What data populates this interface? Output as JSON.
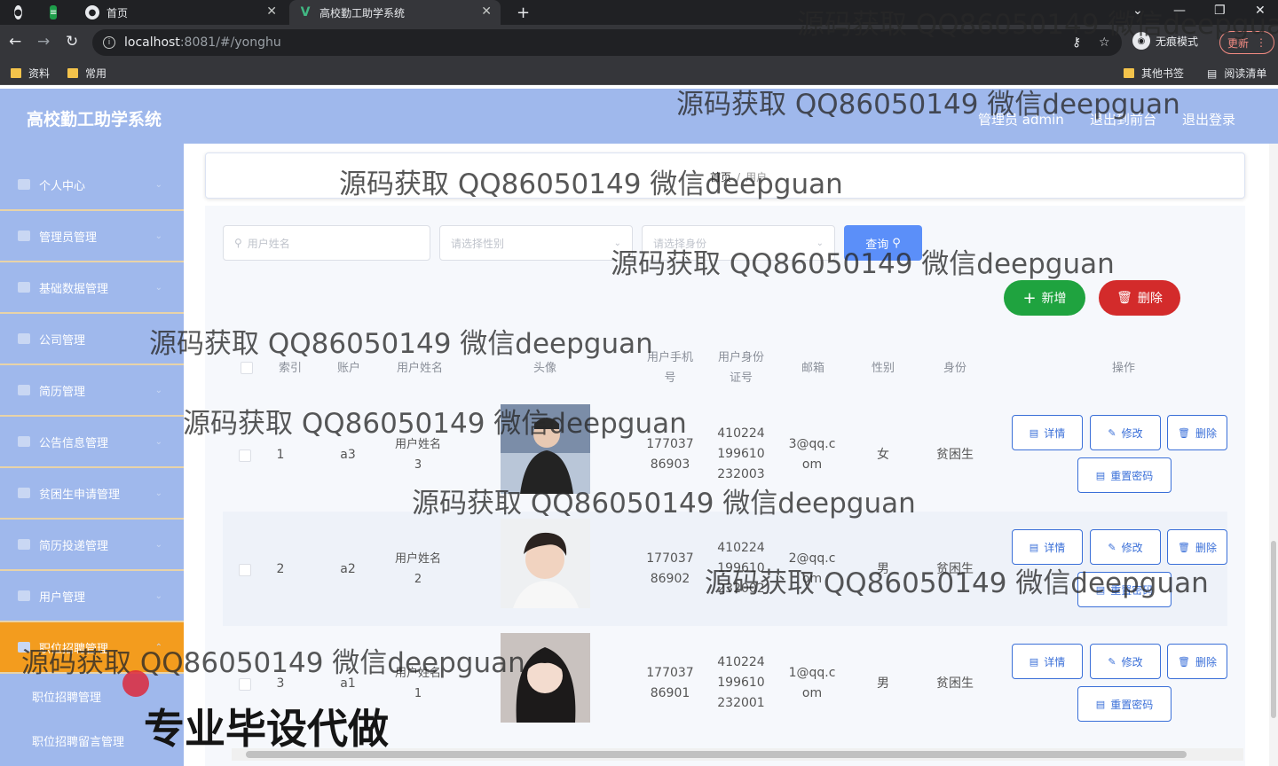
{
  "browser": {
    "tabs": [
      {
        "label": ""
      },
      {
        "label": ""
      },
      {
        "label": "首页"
      },
      {
        "label": "高校勤工助学系统"
      }
    ],
    "new_tab": "+",
    "url_host": "localhost",
    "url_path": ":8081/#/yonghu",
    "incognito_label": "无痕模式",
    "update_label": "更新",
    "bookmarks": [
      "资料",
      "常用"
    ],
    "other_bookmarks": "其他书签",
    "reading_list": "阅读清单"
  },
  "app": {
    "title": "高校勤工助学系统",
    "header_links": {
      "admin": "管理员 admin",
      "front": "退出到前台",
      "logout": "退出登录"
    },
    "menu": [
      {
        "label": "个人中心"
      },
      {
        "label": "管理员管理"
      },
      {
        "label": "基础数据管理"
      },
      {
        "label": "公司管理"
      },
      {
        "label": "简历管理"
      },
      {
        "label": "公告信息管理"
      },
      {
        "label": "贫困生申请管理"
      },
      {
        "label": "简历投递管理"
      },
      {
        "label": "用户管理"
      },
      {
        "label": "职位招聘管理"
      }
    ],
    "submenu": [
      "职位招聘管理",
      "职位招聘留言管理"
    ],
    "breadcrumb": {
      "home": "首页",
      "sep": "/",
      "current": "用户"
    },
    "search": {
      "name_placeholder": "用户姓名",
      "gender_placeholder": "请选择性别",
      "identity_placeholder": "请选择身份",
      "query": "查询"
    },
    "actions": {
      "add": "新增",
      "delete": "删除"
    },
    "table": {
      "headers": {
        "index": "索引",
        "account": "账户",
        "name": "用户姓名",
        "avatar": "头像",
        "phone": "用户手机号",
        "idcard": "用户身份证号",
        "email": "邮箱",
        "gender": "性别",
        "identity": "身份",
        "ops": "操作"
      },
      "rows": [
        {
          "index": "1",
          "account": "a3",
          "name": "用户姓名3",
          "phone": "17703786903",
          "idcard": "410224199610232003",
          "email": "3@qq.com",
          "gender": "女",
          "identity": "贫困生"
        },
        {
          "index": "2",
          "account": "a2",
          "name": "用户姓名2",
          "phone": "17703786902",
          "idcard": "410224199610232002",
          "email": "2@qq.com",
          "gender": "男",
          "identity": "贫困生"
        },
        {
          "index": "3",
          "account": "a1",
          "name": "用户姓名1",
          "phone": "17703786901",
          "idcard": "410224199610232001",
          "email": "1@qq.com",
          "gender": "男",
          "identity": "贫困生"
        }
      ],
      "row_buttons": {
        "detail": "详情",
        "edit": "修改",
        "delete": "删除",
        "reset": "重置密码"
      }
    }
  },
  "overlay": {
    "watermark": "源码获取 QQ86050149 微信deepguan",
    "promo": "专业毕设代做"
  }
}
